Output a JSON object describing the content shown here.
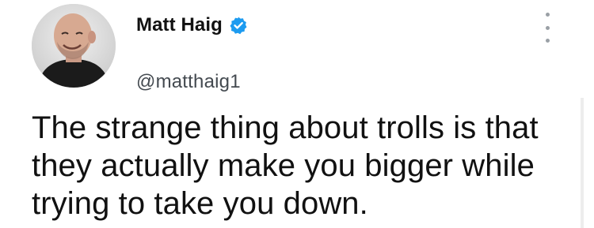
{
  "tweet": {
    "author": {
      "display_name": "Matt Haig",
      "handle": "@matthaig1",
      "verified_icon": "verified-badge-icon",
      "avatar": "profile-photo"
    },
    "text": "The strange thing about trolls is that\nthey actually make you bigger while\ntrying to take you down.",
    "menu_icon": "more-vertical-icon"
  },
  "colors": {
    "verified_blue": "#1d9bf0",
    "text": "#111111",
    "handle": "#444a50",
    "background": "#ffffff"
  }
}
